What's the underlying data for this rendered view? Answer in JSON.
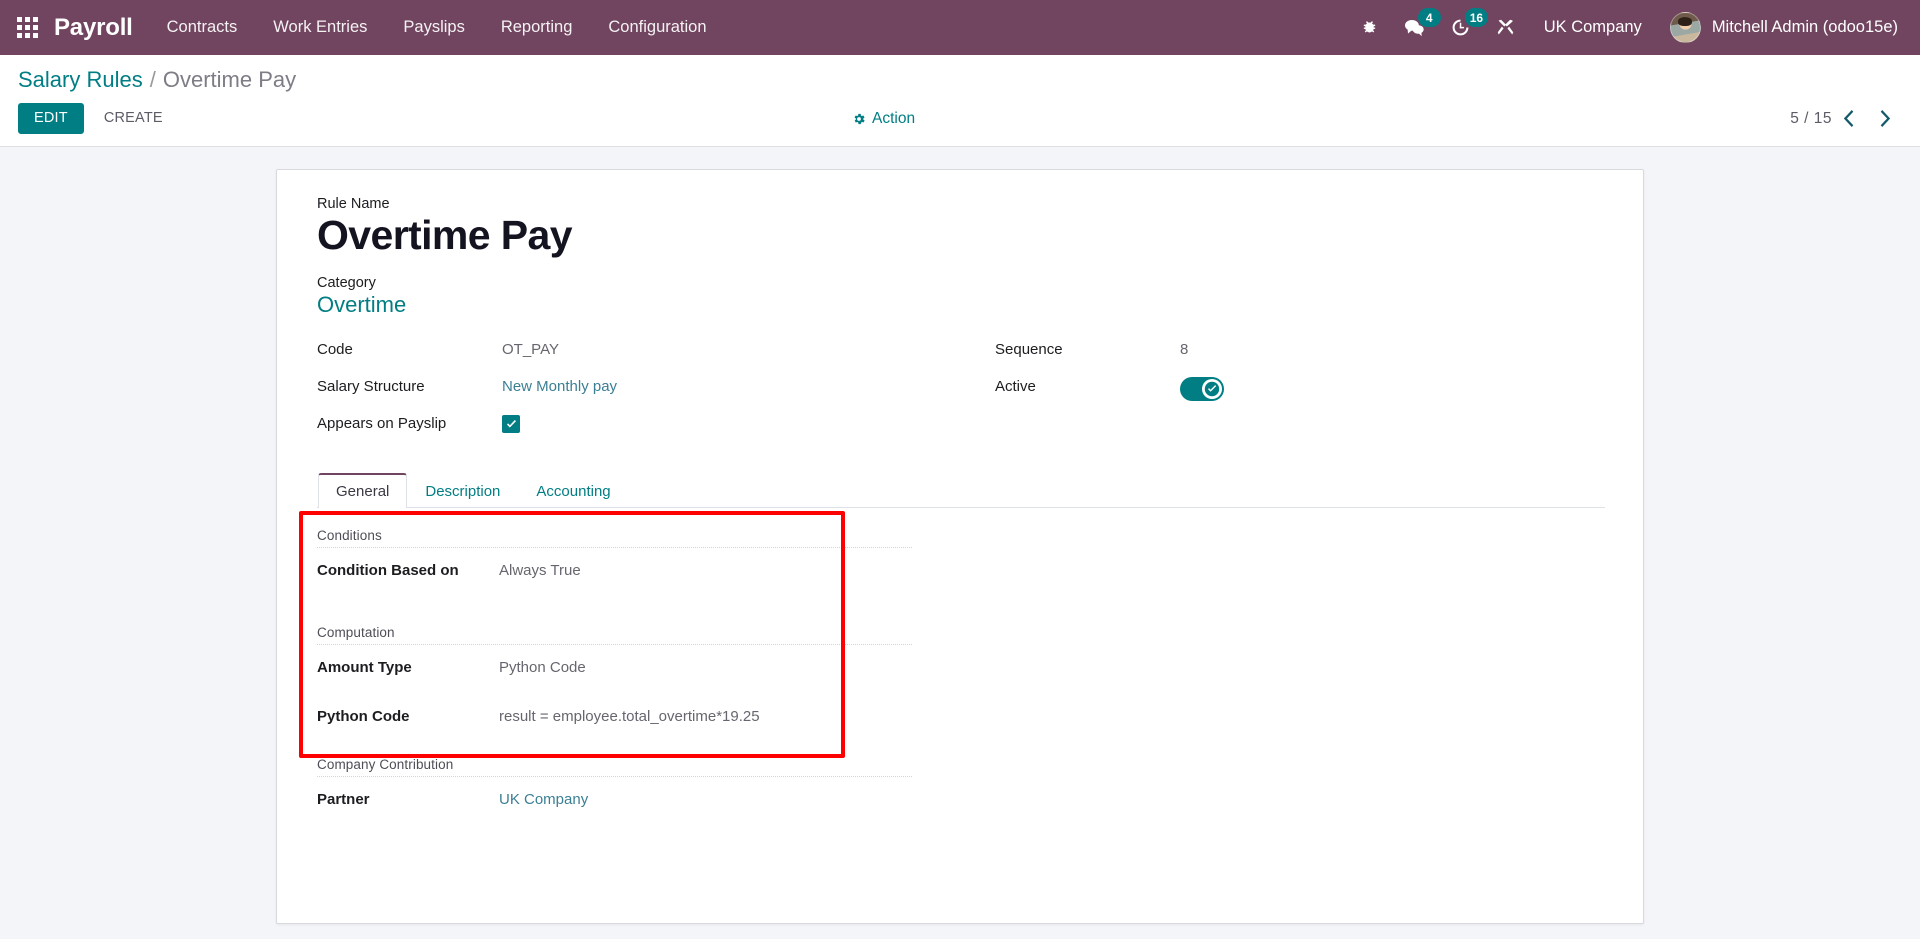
{
  "navbar": {
    "apps_icon": "apps-grid-icon",
    "brand": "Payroll",
    "menu": [
      {
        "label": "Contracts"
      },
      {
        "label": "Work Entries"
      },
      {
        "label": "Payslips"
      },
      {
        "label": "Reporting"
      },
      {
        "label": "Configuration"
      }
    ],
    "icons": {
      "bug": "bug-icon",
      "messages": "messages-icon",
      "messages_badge": "4",
      "activities": "activity-clock-icon",
      "activities_badge": "16",
      "tools": "tools-icon"
    },
    "company": "UK Company",
    "user": "Mitchell Admin (odoo15e)",
    "bg_color": "#71445f"
  },
  "control_panel": {
    "breadcrumb": {
      "root": "Salary Rules",
      "separator": "/",
      "current": "Overtime Pay"
    },
    "edit_label": "EDIT",
    "create_label": "CREATE",
    "action_label": "Action",
    "pager": {
      "value": "5 / 15",
      "prev_icon": "chevron-left-icon",
      "next_icon": "chevron-right-icon"
    },
    "accent_color": "#017e84"
  },
  "form": {
    "rule_name_label": "Rule Name",
    "rule_name_value": "Overtime Pay",
    "category_label": "Category",
    "category_value": "Overtime",
    "left_fields": [
      {
        "label": "Code",
        "value": "OT_PAY"
      },
      {
        "label": "Salary Structure",
        "value": "New Monthly pay"
      },
      {
        "label": "Appears on Payslip",
        "value": ""
      }
    ],
    "right_fields": [
      {
        "label": "Sequence",
        "value": "8"
      },
      {
        "label": "Active",
        "value": ""
      }
    ],
    "tabs": [
      {
        "label": "General",
        "active": true
      },
      {
        "label": "Description",
        "active": false
      },
      {
        "label": "Accounting",
        "active": false
      }
    ],
    "general_tab": {
      "conditions_section": "Conditions",
      "condition_based_on_label": "Condition Based on",
      "condition_based_on_value": "Always True",
      "computation_section": "Computation",
      "amount_type_label": "Amount Type",
      "amount_type_value": "Python Code",
      "python_code_label": "Python Code",
      "python_code_value": "result = employee.total_overtime*19.25",
      "company_contribution_section": "Company Contribution",
      "partner_label": "Partner",
      "partner_value": "UK Company"
    },
    "highlight_color": "#ff0000"
  }
}
